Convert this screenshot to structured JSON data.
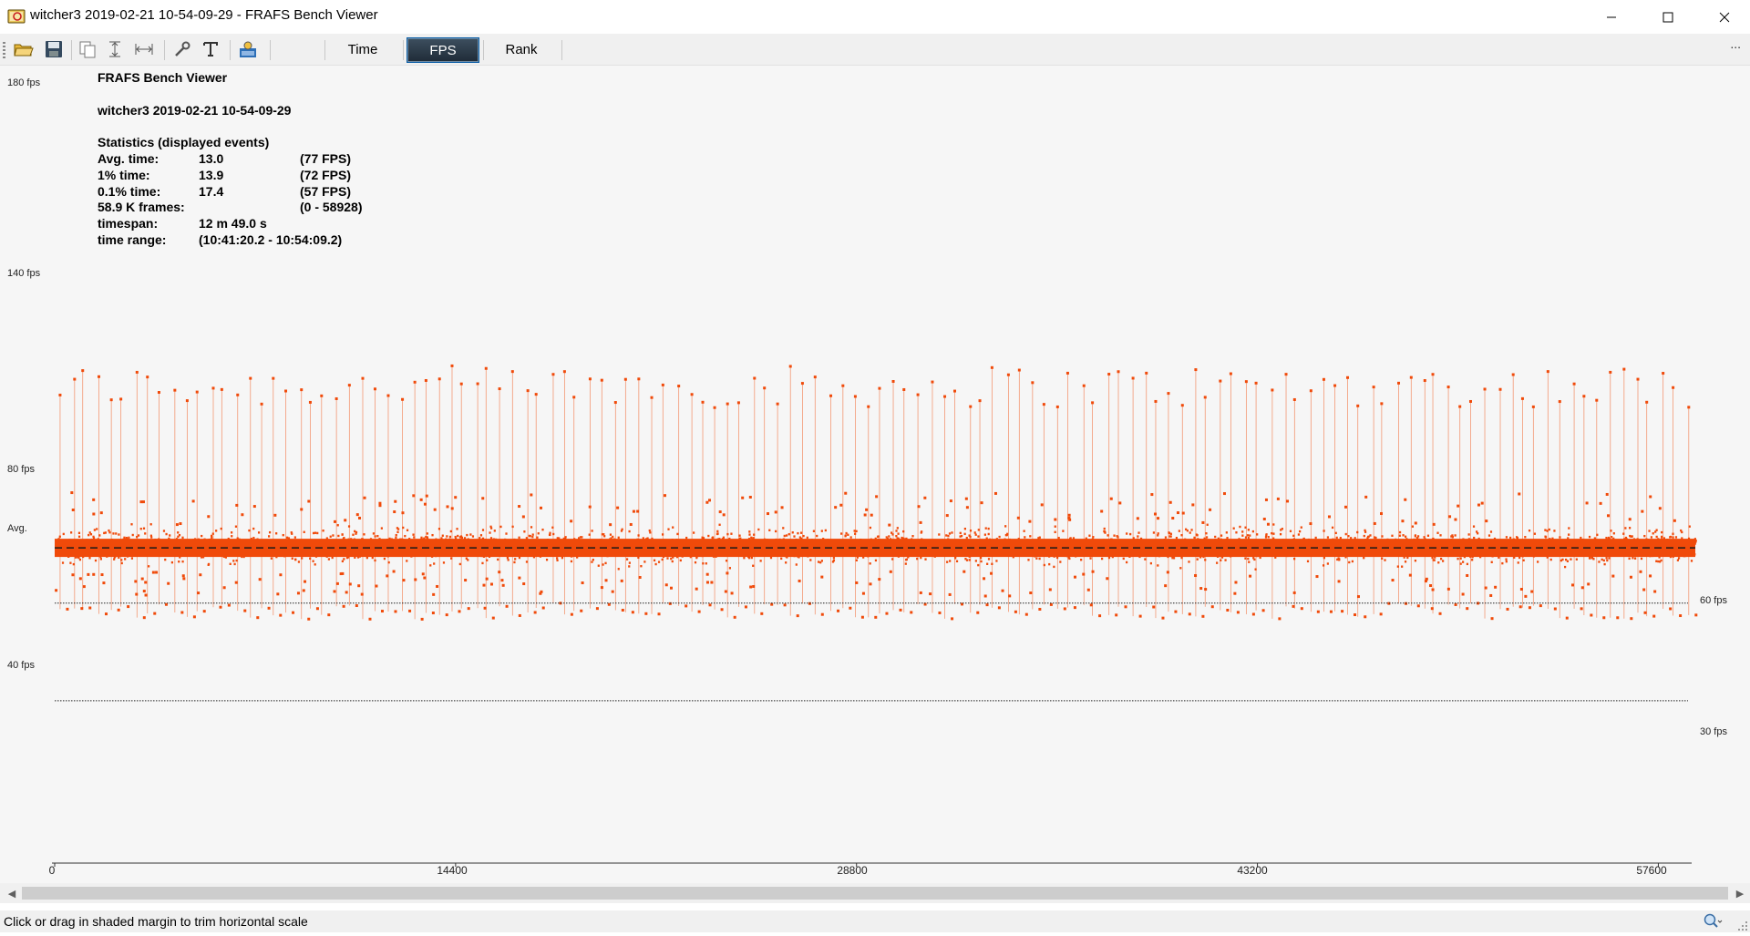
{
  "window": {
    "title": "witcher3 2019-02-21 10-54-09-29 - FRAFS Bench Viewer",
    "controls": [
      "minimize",
      "maximize",
      "close"
    ]
  },
  "toolbar": {
    "icons": [
      "open-folder-icon",
      "save-icon",
      "copy-icon",
      "vertical-scale-icon",
      "horizontal-scale-icon",
      "settings-wrench-icon",
      "text-icon",
      "screenshot-icon"
    ],
    "tabs": [
      {
        "label": "Time",
        "active": false
      },
      {
        "label": "FPS",
        "active": true
      },
      {
        "label": "Rank",
        "active": false
      }
    ],
    "overflow": "..."
  },
  "overlay": {
    "app_name": "FRAFS Bench Viewer",
    "file_name": "witcher3 2019-02-21 10-54-09-29",
    "stats_heading": "Statistics (displayed events)",
    "rows": [
      {
        "label": "Avg. time:",
        "value": "13.0",
        "fps": "(77 FPS)"
      },
      {
        "label": "1% time:",
        "value": "13.9",
        "fps": "(72 FPS)"
      },
      {
        "label": "0.1% time:",
        "value": "17.4",
        "fps": "(57 FPS)"
      },
      {
        "label": "58.9 K frames:",
        "value": "",
        "fps": "(0 - 58928)"
      },
      {
        "label": "timespan:",
        "value": "12 m 49.0 s",
        "fps": ""
      },
      {
        "label": "time range:",
        "value": "(10:41:20.2 - 10:54:09.2)",
        "fps": ""
      }
    ]
  },
  "chart_data": {
    "type": "scatter",
    "y_tick_labels": [
      "180 fps",
      "140 fps",
      "80 fps",
      "Avg.",
      "40 fps"
    ],
    "reference_lines": [
      {
        "label": "60 fps",
        "value": 60
      },
      {
        "label": "30 fps",
        "value": 30
      }
    ],
    "avg_fps": 77,
    "x_ticks": [
      0,
      14400,
      28800,
      43200,
      57600
    ],
    "x_range": [
      0,
      58928
    ],
    "typical_fps_band": [
      70,
      85
    ],
    "spike_high_fps": [
      120,
      133
    ],
    "spike_low_fps": [
      55,
      60
    ],
    "series_color": "#f04a0a"
  },
  "status": {
    "message": "Click or drag in shaded margin to trim horizontal scale"
  }
}
